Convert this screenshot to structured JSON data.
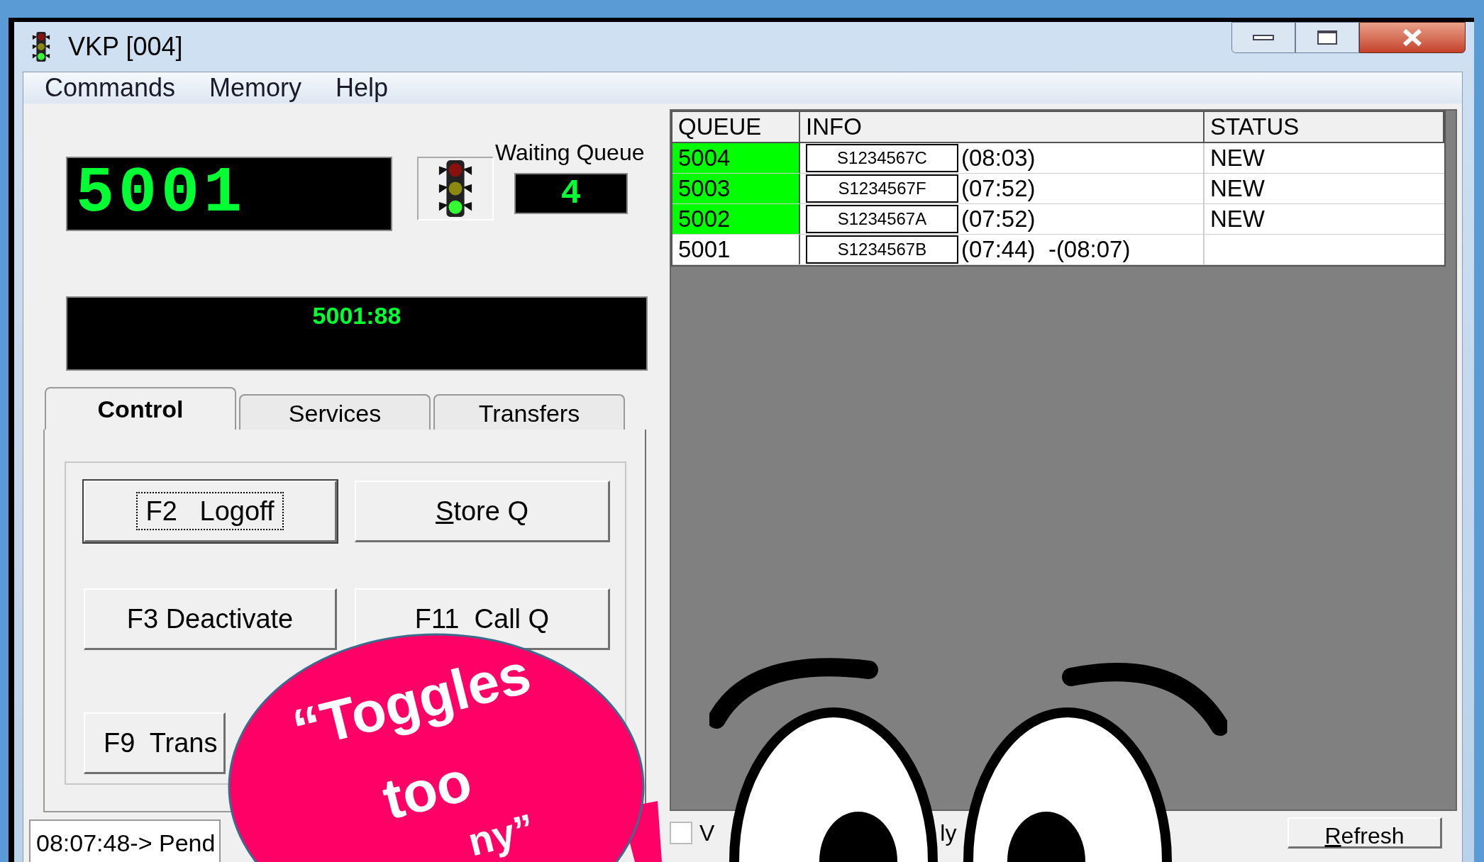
{
  "window": {
    "title": "VKP [004]"
  },
  "menu": [
    "Commands",
    "Memory",
    "Help"
  ],
  "current_number": "5001",
  "waiting_queue": {
    "label": "Waiting Queue",
    "count": "4"
  },
  "message_display": "5001:88",
  "tabs": [
    {
      "label": "Control",
      "selected": true
    },
    {
      "label": "Services",
      "selected": false
    },
    {
      "label": "Transfers",
      "selected": false
    }
  ],
  "buttons": [
    {
      "label": "F2   Logoff",
      "focused": true,
      "mnemonic": false
    },
    {
      "label": "Store Q",
      "focused": false,
      "mnemonic": true
    },
    {
      "label": "F3 Deactivate",
      "focused": false,
      "mnemonic": false
    },
    {
      "label": "F11  Call Q",
      "focused": false,
      "mnemonic": false
    },
    {
      "label": "F9  Trans",
      "focused": false,
      "mnemonic": false
    }
  ],
  "status_line": "08:07:48-> Pend",
  "queue_table": {
    "columns": [
      "QUEUE",
      "INFO",
      "STATUS"
    ],
    "rows": [
      {
        "queue": "5004",
        "highlighted": true,
        "ticket": "S1234567C",
        "info": "(08:03)",
        "status": "NEW"
      },
      {
        "queue": "5003",
        "highlighted": true,
        "ticket": "S1234567F",
        "info": "(07:52)",
        "status": "NEW"
      },
      {
        "queue": "5002",
        "highlighted": true,
        "ticket": "S1234567A",
        "info": "(07:52)",
        "status": "NEW"
      },
      {
        "queue": "5001",
        "highlighted": false,
        "ticket": "S1234567B",
        "info": "(07:44)  -(08:07)"
      }
    ]
  },
  "filter_checkbox": {
    "checked": false,
    "label_start": "V",
    "label_end": "ly"
  },
  "refresh_button": {
    "label": "Refresh",
    "mnemonic": true
  },
  "speech_bubble": {
    "lines": [
      "“Toggles",
      "too",
      "ny”"
    ]
  }
}
